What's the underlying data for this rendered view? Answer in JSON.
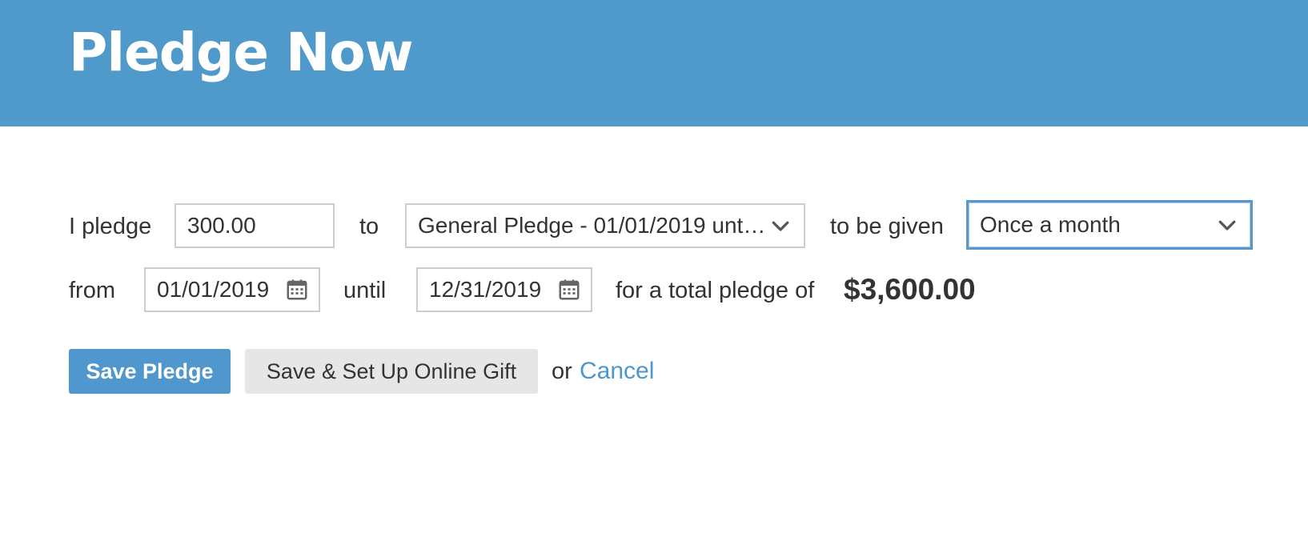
{
  "header": {
    "title": "Pledge Now"
  },
  "form": {
    "i_pledge_label": "I pledge",
    "amount_value": "300.00",
    "to_label": "to",
    "fund_selected": "General Pledge - 01/01/2019 until…",
    "to_be_given_label": "to be given",
    "frequency_selected": "Once a month",
    "from_label": "from",
    "start_date": "01/01/2019",
    "until_label": "until",
    "end_date": "12/31/2019",
    "total_label": "for a total pledge of",
    "total_value": "$3,600.00"
  },
  "actions": {
    "save_label": "Save Pledge",
    "save_online_label": "Save & Set Up Online Gift",
    "or_label": "or",
    "cancel_label": "Cancel"
  },
  "icons": {
    "dropdown": "chevron-down-icon",
    "date": "calendar-icon"
  },
  "colors": {
    "header_bg": "#5099cb",
    "primary_button": "#4f97cc",
    "link": "#4c97cc",
    "secondary_button": "#e6e6e6"
  }
}
